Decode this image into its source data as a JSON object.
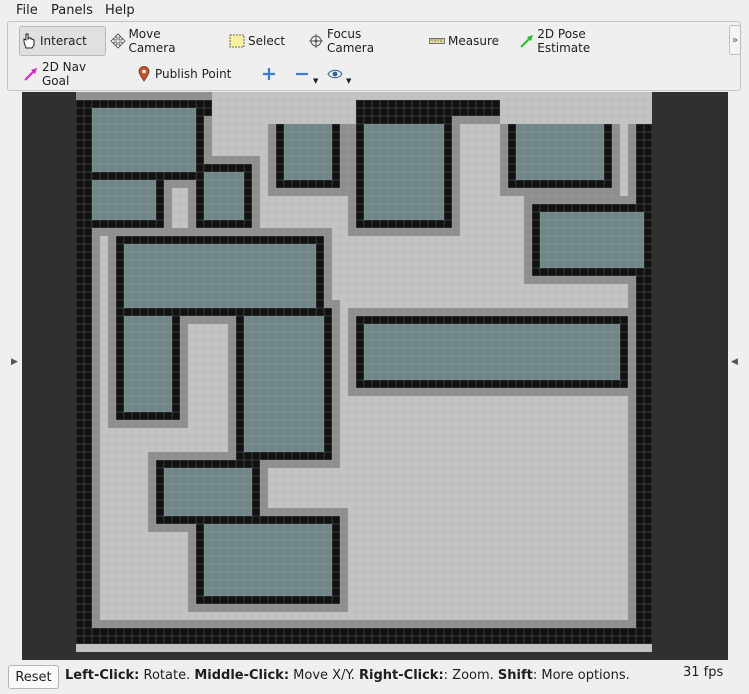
{
  "menu": {
    "file": "File",
    "panels": "Panels",
    "help": "Help"
  },
  "tools": {
    "interact": "Interact",
    "move_camera": "Move Camera",
    "select": "Select",
    "focus_camera": "Focus Camera",
    "measure": "Measure",
    "pose_estimate": "2D Pose Estimate",
    "nav_goal": "2D Nav Goal",
    "publish_point": "Publish Point"
  },
  "status": {
    "reset": "Reset",
    "left_click": "Left-Click:",
    "left_click_desc": " Rotate. ",
    "middle_click": "Middle-Click:",
    "middle_click_desc": " Move X/Y. ",
    "right_click": "Right-Click:",
    "right_click_desc": ": Zoom. ",
    "shift": "Shift",
    "shift_desc": ": More options.",
    "fps": "31 fps"
  },
  "colors": {
    "free": "#c3c3c3",
    "inflation": "#8f8f8f",
    "occupied": "#111111",
    "lethal_core": "#6f8686",
    "grid_line": "#a9a9a9",
    "background": "#303030"
  },
  "map": {
    "cols": 72,
    "rows": 70,
    "shapes": [
      {
        "t": "O",
        "r": [
          0,
          1,
          71,
          68
        ]
      },
      {
        "t": "N",
        "r": [
          17,
          0,
          34,
          3
        ]
      },
      {
        "t": "N",
        "r": [
          53,
          0,
          71,
          3
        ]
      },
      {
        "t": "S",
        "r": [
          1,
          1,
          15,
          10
        ]
      },
      {
        "t": "S",
        "r": [
          1,
          10,
          10,
          16
        ]
      },
      {
        "t": "S",
        "r": [
          15,
          9,
          21,
          16
        ]
      },
      {
        "t": "S",
        "r": [
          25,
          3,
          32,
          11
        ]
      },
      {
        "t": "S",
        "r": [
          35,
          3,
          46,
          16
        ]
      },
      {
        "t": "S",
        "r": [
          54,
          1,
          66,
          11
        ]
      },
      {
        "t": "S",
        "r": [
          57,
          14,
          71,
          22
        ]
      },
      {
        "t": "S",
        "r": [
          5,
          18,
          30,
          27
        ]
      },
      {
        "t": "S",
        "r": [
          5,
          27,
          12,
          40
        ]
      },
      {
        "t": "S",
        "r": [
          20,
          27,
          31,
          45
        ]
      },
      {
        "t": "S",
        "r": [
          35,
          28,
          68,
          36
        ]
      },
      {
        "t": "S",
        "r": [
          10,
          46,
          22,
          53
        ]
      },
      {
        "t": "S",
        "r": [
          15,
          53,
          32,
          63
        ]
      }
    ]
  }
}
